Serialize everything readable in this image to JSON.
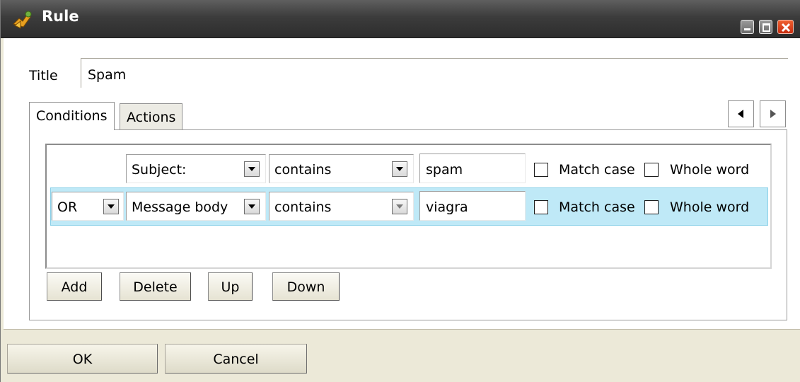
{
  "window": {
    "title": "Rule",
    "app_icon": "rule-icon",
    "controls": [
      "minimize-icon",
      "maximize-icon",
      "close-icon"
    ]
  },
  "title_field": {
    "label": "Title",
    "value": "Spam"
  },
  "tabs": [
    {
      "label": "Conditions",
      "active": true
    },
    {
      "label": "Actions",
      "active": false
    }
  ],
  "conditions": [
    {
      "operator": "",
      "field": "Subject:",
      "match": "contains",
      "value": "spam",
      "match_case_label": "Match case",
      "match_case": false,
      "whole_word_label": "Whole word",
      "whole_word": false,
      "selected": false
    },
    {
      "operator": "OR",
      "field": "Message body",
      "match": "contains",
      "value": "viagra",
      "match_case_label": "Match case",
      "match_case": false,
      "whole_word_label": "Whole word",
      "whole_word": false,
      "selected": true
    }
  ],
  "buttons": {
    "add": "Add",
    "delete": "Delete",
    "up": "Up",
    "down": "Down",
    "ok": "OK",
    "cancel": "Cancel"
  },
  "colors": {
    "titlebar": "#3c3c3c",
    "selected_row": "#bfe9f7",
    "close_button": "#e04020"
  }
}
